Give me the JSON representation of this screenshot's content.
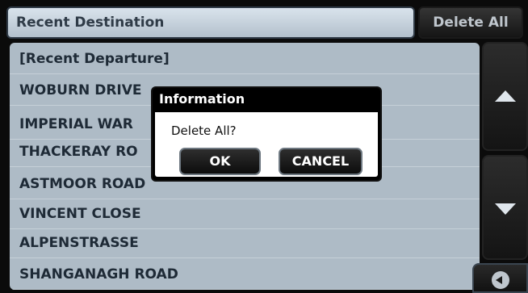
{
  "header": {
    "title": "Recent Destination",
    "delete_all_label": "Delete All"
  },
  "list": {
    "items": [
      "[Recent Departure]",
      "WOBURN DRIVE",
      "IMPERIAL WAR",
      "THACKERAY RO",
      "ASTMOOR ROAD",
      "VINCENT CLOSE",
      "ALPENSTRASSE",
      "SHANGANAGH ROAD"
    ]
  },
  "dialog": {
    "title": "Information",
    "message": "Delete All?",
    "ok_label": "OK",
    "cancel_label": "CANCEL"
  },
  "icons": {
    "scroll_up": "triangle-up-icon",
    "scroll_down": "triangle-down-icon",
    "back": "back-arrow-icon"
  }
}
